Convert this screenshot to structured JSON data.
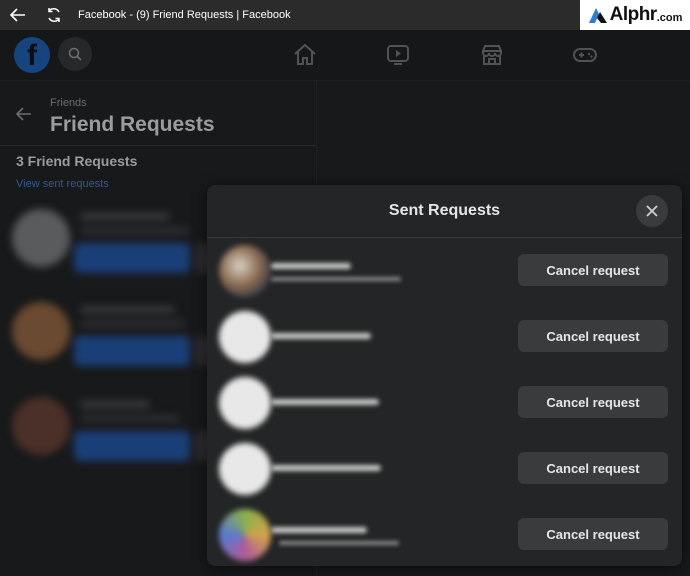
{
  "window": {
    "title": "Facebook - (9) Friend Requests | Facebook"
  },
  "watermark": {
    "brand": "Alphr",
    "suffix": ".com"
  },
  "nav": {
    "logo_letter": "f",
    "icons": [
      "home-icon",
      "watch-icon",
      "marketplace-icon",
      "gaming-icon"
    ]
  },
  "left_panel": {
    "breadcrumb": "Friends",
    "title": "Friend Requests",
    "count_label": "3 Friend Requests",
    "view_sent_link": "View sent requests"
  },
  "modal": {
    "title": "Sent Requests",
    "rows": [
      {
        "button": "Cancel request"
      },
      {
        "button": "Cancel request"
      },
      {
        "button": "Cancel request"
      },
      {
        "button": "Cancel request"
      },
      {
        "button": "Cancel request"
      }
    ]
  },
  "colors": {
    "background": "#18191a",
    "modal_bg": "#242526",
    "button_bg": "#3a3b3c",
    "primary_text": "#e4e6eb",
    "fb_blue": "#1877f2"
  }
}
